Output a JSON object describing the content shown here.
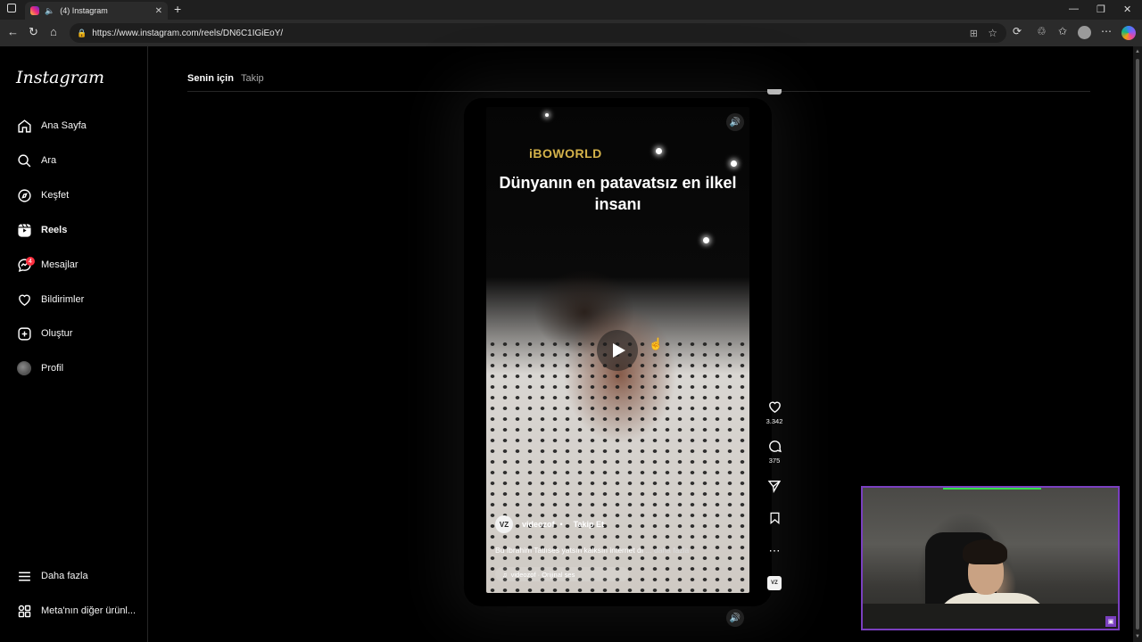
{
  "browser": {
    "tab_title": "(4) Instagram",
    "url": "https://www.instagram.com/reels/DN6C1IGiEoY/",
    "new_tab_label": "+",
    "window_controls": [
      "minimize-icon",
      "restore-icon",
      "close-icon"
    ]
  },
  "sidebar": {
    "logo": "Instagram",
    "items": [
      {
        "label": "Ana Sayfa",
        "icon": "home-icon"
      },
      {
        "label": "Ara",
        "icon": "search-icon"
      },
      {
        "label": "Keşfet",
        "icon": "compass-icon"
      },
      {
        "label": "Reels",
        "icon": "reels-icon",
        "active": true
      },
      {
        "label": "Mesajlar",
        "icon": "messenger-icon",
        "badge": "4"
      },
      {
        "label": "Bildirimler",
        "icon": "heart-icon"
      },
      {
        "label": "Oluştur",
        "icon": "plus-square-icon"
      },
      {
        "label": "Profil",
        "icon": "profile-avatar"
      }
    ],
    "more_label": "Daha fazla",
    "meta_label": "Meta'nın diğer ürünl..."
  },
  "feed_tabs": {
    "for_you": "Senin için",
    "following": "Takip"
  },
  "reel": {
    "brand_text": "iBOWORLD",
    "headline": "Dünyanın en patavatsız en ilkel insanı",
    "username": "videozof",
    "separator": "•",
    "follow_label": "Takip Et",
    "caption": "Bu İbrahim Tatlıses yatsın kalksın internet dı",
    "caption_more": "... daha fazla",
    "audio": "videozof · Orijinal ses",
    "avatar_text": "VZ",
    "likes": "3.342",
    "comments": "375"
  },
  "colors": {
    "background": "#000000",
    "accent_badge": "#ff3040",
    "brand_gold": "#d4b24a",
    "webcam_border": "#7a3fbf",
    "webcam_bar": "#34e04b"
  }
}
